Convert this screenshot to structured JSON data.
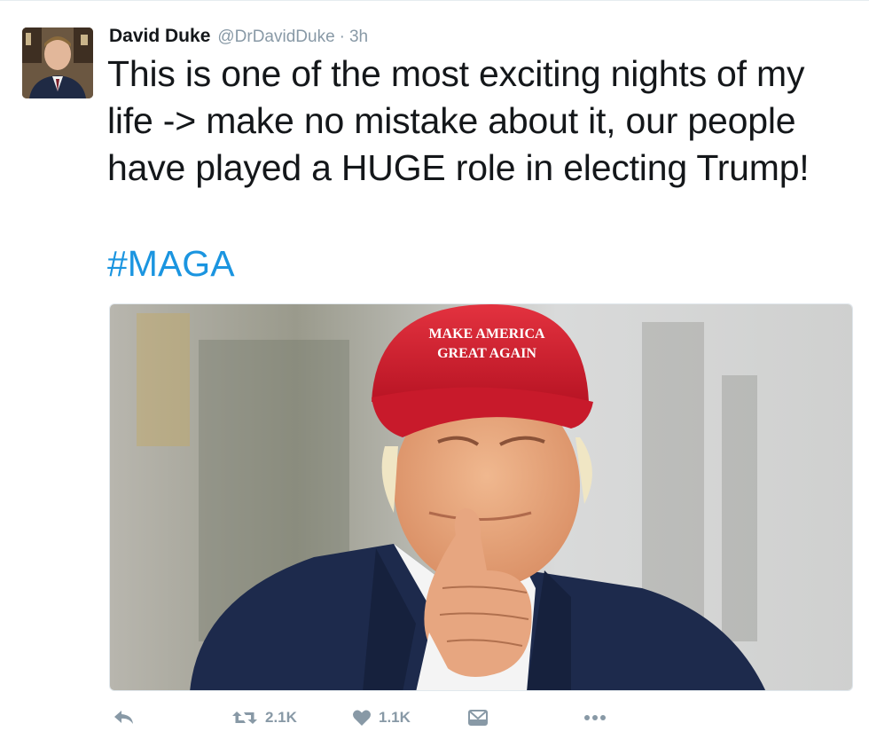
{
  "tweet": {
    "display_name": "David Duke",
    "handle": "@DrDavidDuke",
    "separator": "·",
    "timestamp": "3h",
    "text": "This is one of the most exciting nights of my life -> make no mistake about it, our people have played a HUGE role in electing Trump!",
    "hashtag": "#MAGA"
  },
  "media": {
    "cap_text_line1": "MAKE AMERICA",
    "cap_text_line2": "GREAT AGAIN"
  },
  "actions": {
    "retweet_count": "2.1K",
    "like_count": "1.1K"
  },
  "colors": {
    "link": "#1b95e0",
    "muted": "#8899a6",
    "text": "#14171a",
    "cap_red": "#c8102e"
  },
  "icons": [
    "reply-icon",
    "retweet-icon",
    "heart-icon",
    "dm-icon",
    "more-icon"
  ]
}
